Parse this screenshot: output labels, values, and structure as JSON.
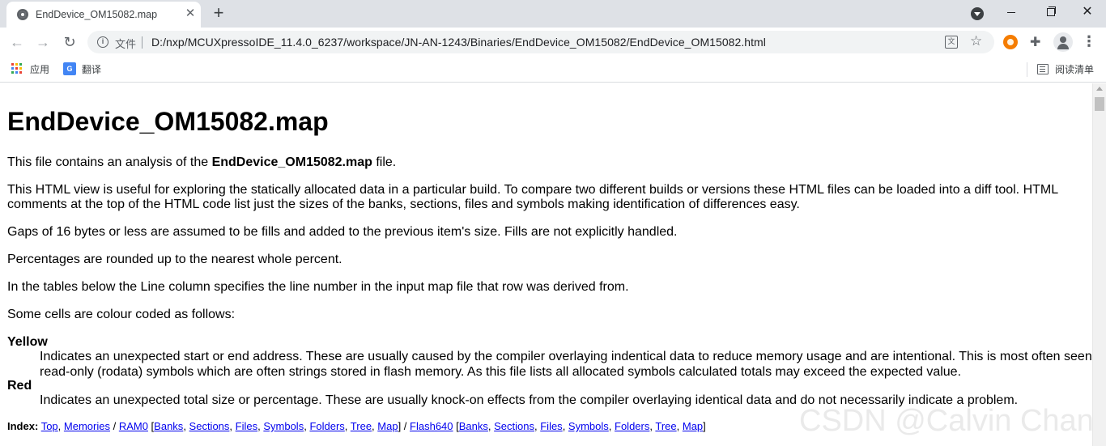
{
  "browser": {
    "tab_title": "EndDevice_OM15082.map",
    "tab_close": "✕",
    "new_tab": "+",
    "omnibox_file_label": "文件",
    "url": "D:/nxp/MCUXpressoIDE_11.4.0_6237/workspace/JN-AN-1243/Binaries/EndDevice_OM15082/EndDevice_OM15082.html",
    "bookmarks": {
      "apps_label": "应用",
      "translate_label": "翻译",
      "reading_list_label": "阅读清单"
    },
    "colors": {
      "tabstrip": "#dee1e6",
      "omnibox": "#f1f3f4",
      "extension": "#f57c00"
    }
  },
  "page": {
    "title": "EndDevice_OM15082.map",
    "intro_prefix": "This file contains an analysis of the ",
    "intro_bold": "EndDevice_OM15082.map",
    "intro_suffix": " file.",
    "p_html_view": "This HTML view is useful for exploring the statically allocated data in a particular build. To compare two different builds or versions these HTML files can be loaded into a diff tool. HTML comments at the top of the HTML code list just the sizes of the banks, sections, files and symbols making identification of differences easy.",
    "p_gaps": "Gaps of 16 bytes or less are assumed to be fills and added to the previous item's size. Fills are not explicitly handled.",
    "p_percent": "Percentages are rounded up to the nearest whole percent.",
    "p_line_col": "In the tables below the Line column specifies the line number in the input map file that row was derived from.",
    "p_colour": "Some cells are colour coded as follows:",
    "legend": [
      {
        "term": "Yellow",
        "line1": "Indicates an unexpected start or end address. These are usually caused by the compiler overlaying indentical data to reduce memory usage and are intentional. This is most often seen",
        "line2": "read-only (rodata) symbols which are often strings stored in flash memory. As this file lists all allocated symbols calculated totals may exceed the expected value."
      },
      {
        "term": "Red",
        "line1": "Indicates an unexpected total size or percentage. These are usually knock-on effects from the compiler overlaying identical data and do not necessarily indicate a problem."
      }
    ],
    "index": {
      "label": "Index:",
      "top": "Top",
      "memories": "Memories",
      "ram0": "RAM0",
      "ram0_links": [
        "Banks",
        "Sections",
        "Files",
        "Symbols",
        "Folders",
        "Tree",
        "Map"
      ],
      "flash": "Flash640",
      "flash_links": [
        "Banks",
        "Sections",
        "Files",
        "Symbols",
        "Folders",
        "Tree",
        "Map"
      ]
    },
    "watermark": "CSDN @Calvin Chan",
    "link_color": "#0000ee"
  }
}
